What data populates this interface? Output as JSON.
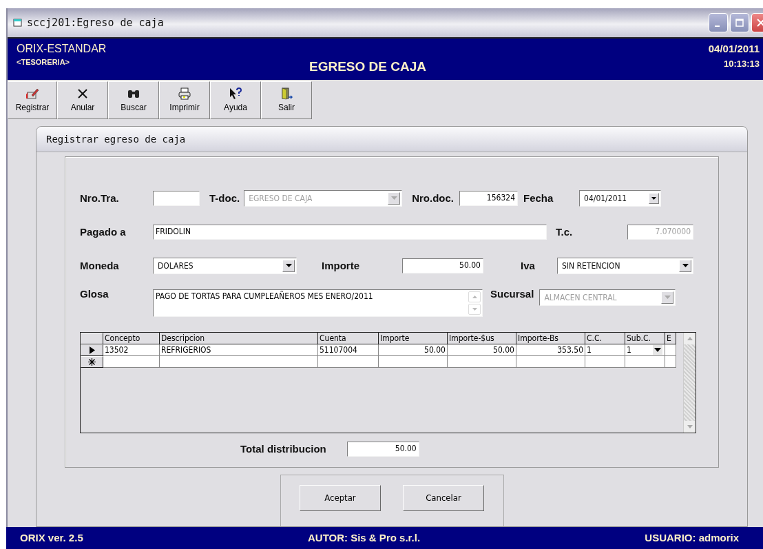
{
  "window": {
    "title": "sccj201:Egreso de caja"
  },
  "header": {
    "company": "ORIX-ESTANDAR",
    "module": "<TESORERIA>",
    "title": "EGRESO DE CAJA",
    "date": "04/01/2011",
    "time": "10:13:13"
  },
  "toolbar": [
    {
      "kind": "register",
      "label": "Registrar"
    },
    {
      "kind": "cancel",
      "label": "Anular"
    },
    {
      "kind": "search",
      "label": "Buscar"
    },
    {
      "kind": "print",
      "label": "Imprimir"
    },
    {
      "kind": "help",
      "label": "Ayuda"
    },
    {
      "kind": "exit",
      "label": "Salir"
    }
  ],
  "panel": {
    "title": "Registrar egreso de caja"
  },
  "form": {
    "nro_tra": {
      "label": "Nro.Tra."
    },
    "t_doc": {
      "label": "T-doc.",
      "value": "EGRESO DE CAJA",
      "disabled": true
    },
    "nro_doc": {
      "label": "Nro.doc.",
      "value": "156324"
    },
    "fecha": {
      "label": "Fecha",
      "value": "04/01/2011"
    },
    "pagado_a": {
      "label": "Pagado a",
      "value": "FRIDOLIN"
    },
    "tc": {
      "label": "T.c.",
      "value": "7.070000",
      "disabled": true
    },
    "moneda": {
      "label": "Moneda",
      "value": "DOLARES",
      "disabled": false
    },
    "importe": {
      "label": "Importe",
      "value": "50.00"
    },
    "iva": {
      "label": "Iva",
      "value": "SIN RETENCION",
      "disabled": false
    },
    "glosa": {
      "label": "Glosa",
      "value": "PAGO DE TORTAS PARA CUMPLEAÑEROS MES ENERO/2011"
    },
    "sucursal": {
      "label": "Sucursal",
      "value": "ALMACEN CENTRAL",
      "disabled": true
    }
  },
  "grid": {
    "columns": [
      "Concepto",
      "Descripcion",
      "Cuenta",
      "Importe",
      "Importe-$us",
      "Importe-Bs",
      "C.C.",
      "Sub.C.",
      "E"
    ],
    "rows": [
      {
        "kind": "current",
        "cells": [
          "13502",
          "REFRIGERIOS",
          "51107004",
          "50.00",
          "50.00",
          "353.50",
          "1",
          "1",
          ""
        ]
      },
      {
        "kind": "new",
        "cells": [
          "",
          "",
          "",
          "",
          "",
          "",
          "",
          "",
          ""
        ]
      }
    ]
  },
  "total": {
    "label": "Total distribucion",
    "value": "50.00"
  },
  "buttons": [
    "Aceptar",
    "Cancelar"
  ],
  "status_bar": {
    "version": "ORIX ver. 2.5",
    "author": "AUTOR: Sis & Pro s.r.l.",
    "user": "USUARIO: admorix"
  }
}
